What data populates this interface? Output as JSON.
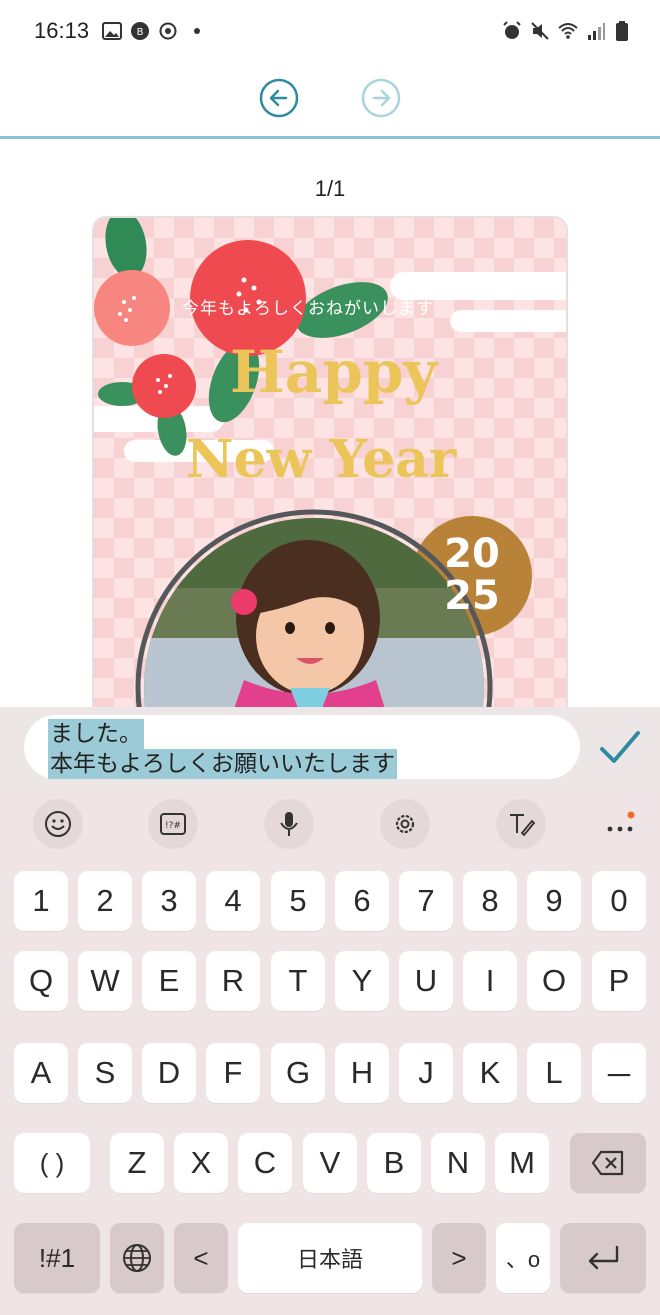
{
  "status_bar": {
    "time": "16:13"
  },
  "page_indicator": "1/1",
  "card": {
    "greeting_line": "今年もよろしくおねがいします",
    "happy": "Happy",
    "new_year": "New Year",
    "year_top": "20",
    "year_bottom": "25"
  },
  "editor": {
    "line1": "ました。",
    "line2": "本年もよろしくお願いいたします"
  },
  "keyboard": {
    "row_numbers": [
      "1",
      "2",
      "3",
      "4",
      "5",
      "6",
      "7",
      "8",
      "9",
      "0"
    ],
    "row_q": [
      "Q",
      "W",
      "E",
      "R",
      "T",
      "Y",
      "U",
      "I",
      "O",
      "P"
    ],
    "row_a": [
      "A",
      "S",
      "D",
      "F",
      "G",
      "H",
      "J",
      "K",
      "L",
      "－"
    ],
    "row_z_paren": "( )",
    "row_z": [
      "Z",
      "X",
      "C",
      "V",
      "B",
      "N",
      "M"
    ],
    "symbols_key": "!#1",
    "space_label": "日本語",
    "left_arrow": "<",
    "right_arrow": ">",
    "punct_key": "、o"
  },
  "colors": {
    "accent_teal": "#2e8aa0",
    "card_pink": "#fde3e3",
    "camellia_red": "#ef4a50",
    "gold_text": "#ecc55a",
    "year_badge": "#b88338"
  }
}
